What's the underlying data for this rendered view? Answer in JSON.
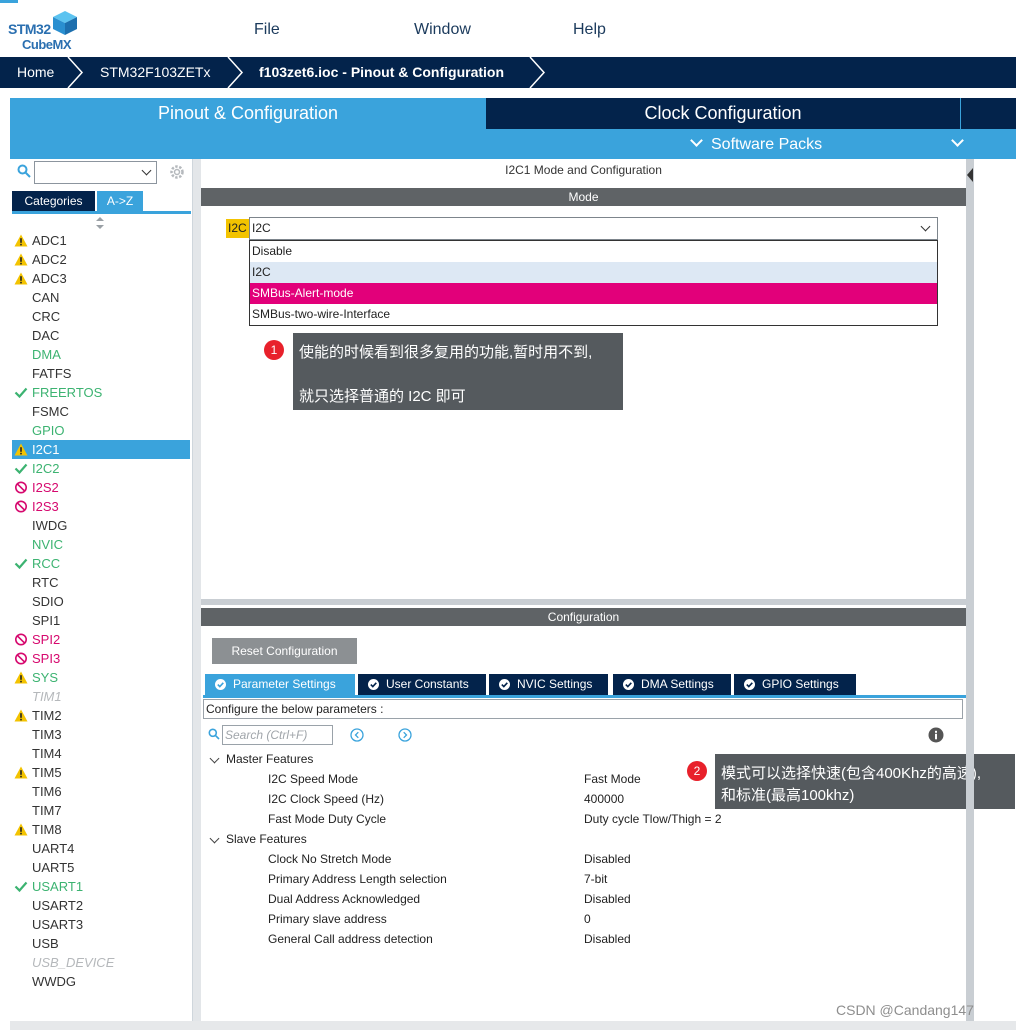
{
  "app": {
    "logo_top": "STM32",
    "logo_bottom": "CubeMX"
  },
  "menu": {
    "file": "File",
    "window": "Window",
    "help": "Help"
  },
  "breadcrumb": {
    "home": "Home",
    "device": "STM32F103ZETx",
    "current": "f103zet6.ioc - Pinout & Configuration"
  },
  "tabs": {
    "pinout": "Pinout & Configuration",
    "clock": "Clock Configuration",
    "software_packs": "Software Packs",
    "pinout_sub": "Pinout"
  },
  "sidebar": {
    "search_value": "",
    "categories_tab": "Categories",
    "az_tab": "A->Z",
    "items": [
      {
        "label": "ADC1",
        "status": "warning"
      },
      {
        "label": "ADC2",
        "status": "warning"
      },
      {
        "label": "ADC3",
        "status": "warning"
      },
      {
        "label": "CAN",
        "status": "none"
      },
      {
        "label": "CRC",
        "status": "none"
      },
      {
        "label": "DAC",
        "status": "none"
      },
      {
        "label": "DMA",
        "status": "green"
      },
      {
        "label": "FATFS",
        "status": "none"
      },
      {
        "label": "FREERTOS",
        "status": "check"
      },
      {
        "label": "FSMC",
        "status": "none"
      },
      {
        "label": "GPIO",
        "status": "green"
      },
      {
        "label": "I2C1",
        "status": "selected-warning"
      },
      {
        "label": "I2C2",
        "status": "check"
      },
      {
        "label": "I2S2",
        "status": "disabled"
      },
      {
        "label": "I2S3",
        "status": "disabled"
      },
      {
        "label": "IWDG",
        "status": "none"
      },
      {
        "label": "NVIC",
        "status": "green"
      },
      {
        "label": "RCC",
        "status": "check"
      },
      {
        "label": "RTC",
        "status": "none"
      },
      {
        "label": "SDIO",
        "status": "none"
      },
      {
        "label": "SPI1",
        "status": "none"
      },
      {
        "label": "SPI2",
        "status": "disabled"
      },
      {
        "label": "SPI3",
        "status": "disabled"
      },
      {
        "label": "SYS",
        "status": "warning-green"
      },
      {
        "label": "TIM1",
        "status": "unavailable"
      },
      {
        "label": "TIM2",
        "status": "warning"
      },
      {
        "label": "TIM3",
        "status": "none"
      },
      {
        "label": "TIM4",
        "status": "none"
      },
      {
        "label": "TIM5",
        "status": "warning"
      },
      {
        "label": "TIM6",
        "status": "none"
      },
      {
        "label": "TIM7",
        "status": "none"
      },
      {
        "label": "TIM8",
        "status": "warning"
      },
      {
        "label": "UART4",
        "status": "none"
      },
      {
        "label": "UART5",
        "status": "none"
      },
      {
        "label": "USART1",
        "status": "check"
      },
      {
        "label": "USART2",
        "status": "none"
      },
      {
        "label": "USART3",
        "status": "none"
      },
      {
        "label": "USB",
        "status": "none"
      },
      {
        "label": "USB_DEVICE",
        "status": "unavailable"
      },
      {
        "label": "WWDG",
        "status": "none"
      }
    ]
  },
  "mode_panel": {
    "title": "I2C1 Mode and Configuration",
    "mode_header": "Mode",
    "i2c_label": "I2C",
    "selected": "I2C",
    "options": [
      "Disable",
      "I2C",
      "SMBus-Alert-mode",
      "SMBus-two-wire-Interface"
    ]
  },
  "annotations": {
    "note1_badge": "1",
    "note1_line1": "使能的时候看到很多复用的功能,暂时用不到,",
    "note1_line2": "就只选择普通的 I2C 即可",
    "note2_badge": "2",
    "note2_line1": "模式可以选择快速(包含400Khz的高速),",
    "note2_line2": "和标准(最高100khz)"
  },
  "config_panel": {
    "header": "Configuration",
    "reset_button": "Reset Configuration",
    "tabs": [
      "Parameter Settings",
      "User Constants",
      "NVIC Settings",
      "DMA Settings",
      "GPIO Settings"
    ],
    "hint": "Configure the below parameters :",
    "search_placeholder": "Search (Ctrl+F)",
    "groups": [
      {
        "name": "Master Features",
        "params": [
          {
            "name": "I2C Speed Mode",
            "value": "Fast Mode"
          },
          {
            "name": "I2C Clock Speed (Hz)",
            "value": "400000"
          },
          {
            "name": "Fast Mode Duty Cycle",
            "value": "Duty cycle Tlow/Thigh = 2"
          }
        ]
      },
      {
        "name": "Slave Features",
        "params": [
          {
            "name": "Clock No Stretch Mode",
            "value": "Disabled"
          },
          {
            "name": "Primary Address Length selection",
            "value": "7-bit"
          },
          {
            "name": "Dual Address Acknowledged",
            "value": "Disabled"
          },
          {
            "name": "Primary slave address",
            "value": "0"
          },
          {
            "name": "General Call address detection",
            "value": "Disabled"
          }
        ]
      }
    ]
  },
  "watermark": "CSDN @Candang147",
  "colors": {
    "accent_blue": "#3aa3dc",
    "navy": "#03234b",
    "selected_option": "#e2007a",
    "warning": "#f3c300",
    "ok_green": "#3cb371",
    "disabled_pink": "#d6086e"
  }
}
